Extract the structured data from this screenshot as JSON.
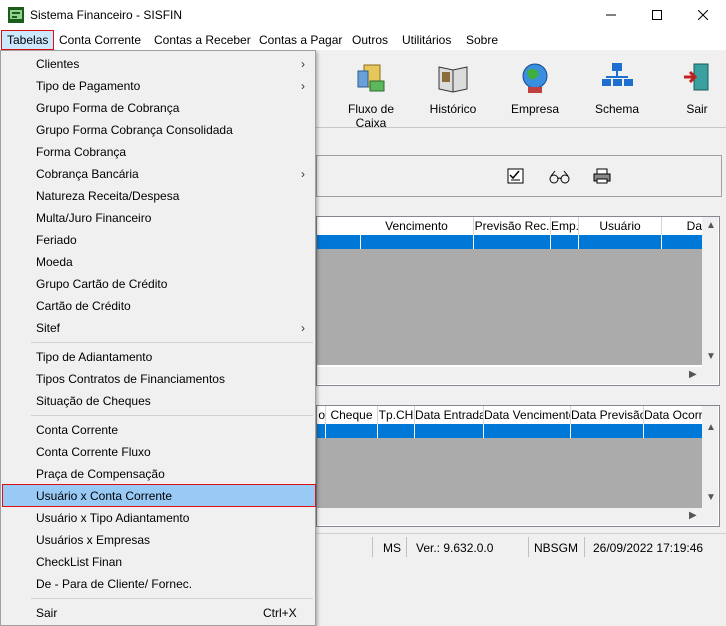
{
  "window": {
    "title": "Sistema Financeiro - SISFIN"
  },
  "menubar": {
    "items": [
      {
        "label": "Tabelas"
      },
      {
        "label": "Conta Corrente"
      },
      {
        "label": "Contas a Receber"
      },
      {
        "label": "Contas a Pagar"
      },
      {
        "label": "Outros"
      },
      {
        "label": "Utilitários"
      },
      {
        "label": "Sobre"
      }
    ]
  },
  "toolbar": {
    "buttons": [
      {
        "label": "Fluxo de Caixa",
        "icon": "cash-flow-icon"
      },
      {
        "label": "Histórico",
        "icon": "book-icon"
      },
      {
        "label": "Empresa",
        "icon": "globe-icon"
      },
      {
        "label": "Schema",
        "icon": "network-icon"
      },
      {
        "label": "Sair",
        "icon": "exit-icon"
      }
    ]
  },
  "grid_top": {
    "columns": [
      "Vencimento",
      "Previsão Rec.",
      "Emp.",
      "Usuário",
      "Da"
    ]
  },
  "grid_bottom": {
    "columns": [
      "o",
      "Cheque",
      "Tp.CH",
      "Data Entrada",
      "Data Vencimento",
      "Data Previsão",
      "Data Ocorrê"
    ]
  },
  "statusbar": {
    "ms": "MS",
    "version": "Ver.: 9.632.0.0",
    "user": "NBSGM",
    "datetime": "26/09/2022 17:19:46"
  },
  "dropdown": {
    "items": [
      {
        "label": "Clientes",
        "submenu": "›"
      },
      {
        "label": "Tipo de Pagamento",
        "submenu": "›"
      },
      {
        "label": "Grupo Forma de Cobrança"
      },
      {
        "label": "Grupo Forma Cobrança Consolidada"
      },
      {
        "label": "Forma Cobrança"
      },
      {
        "label": "Cobrança Bancária",
        "submenu": "›"
      },
      {
        "label": "Natureza Receita/Despesa"
      },
      {
        "label": "Multa/Juro Financeiro"
      },
      {
        "label": "Feriado"
      },
      {
        "label": "Moeda"
      },
      {
        "label": "Grupo Cartão de Crédito"
      },
      {
        "label": "Cartão de Crédito"
      },
      {
        "label": "Sitef",
        "submenu": "›"
      },
      {
        "label": "Tipo de Adiantamento"
      },
      {
        "label": "Tipos Contratos de Financiamentos"
      },
      {
        "label": "Situação de Cheques"
      },
      {
        "label": "Conta Corrente"
      },
      {
        "label": "Conta Corrente Fluxo"
      },
      {
        "label": "Praça de Compensação"
      },
      {
        "label": "Usuário x Conta Corrente"
      },
      {
        "label": "Usuário x Tipo Adiantamento"
      },
      {
        "label": "Usuários x Empresas"
      },
      {
        "label": "CheckList Finan"
      },
      {
        "label": "De - Para de Cliente/ Fornec."
      },
      {
        "label": "Sair",
        "shortcut": "Ctrl+X"
      }
    ]
  },
  "colors": {
    "selection": "#0078d7",
    "menu_highlight": "#99c9f5",
    "focus_border": "#dd1111"
  }
}
